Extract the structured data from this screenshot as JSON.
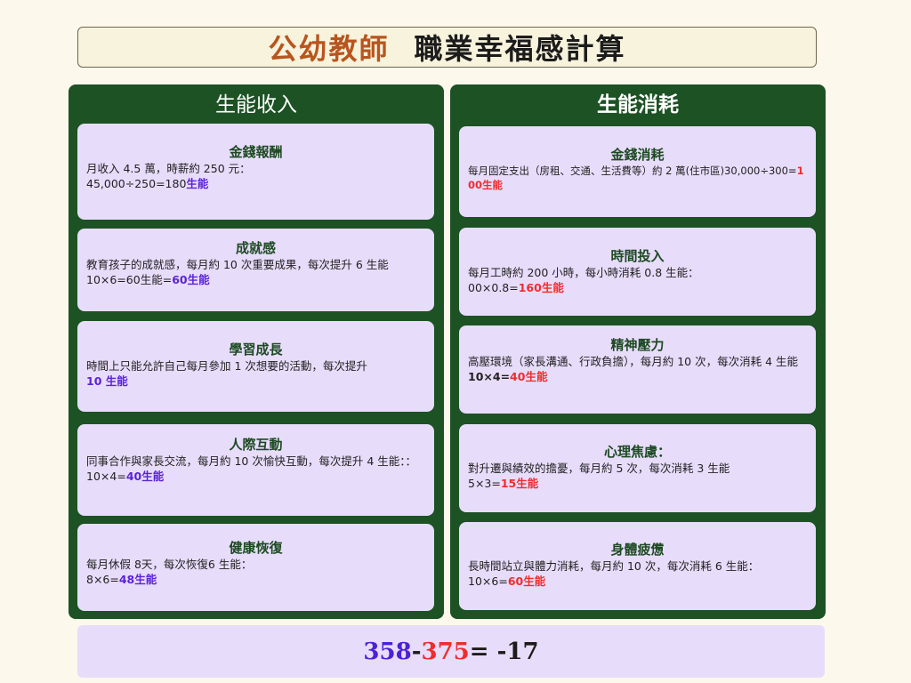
{
  "title": {
    "part1": "公幼教師",
    "part2": "職業幸福感計算"
  },
  "income": {
    "heading": "生能收入",
    "cards": [
      {
        "title": "金錢報酬",
        "line1": "月收入 4.5 萬，時薪約 250 元：",
        "calc": "45,000÷250=180",
        "result": "生能"
      },
      {
        "title": "成就感",
        "line1": "教育孩子的成就感，每月約 10 次重要成果，每次提升 6 生能",
        "calc": "10×6=60生能=",
        "result": "60生能"
      },
      {
        "title": "學習成長",
        "line1": "時間上只能允許自己每月參加 1 次想要的活動，每次提升",
        "result": "10 生能"
      },
      {
        "title": "人際互動",
        "line1": "同事合作與家長交流，每月約 10 次愉快互動，每次提升 4 生能：：",
        "calc": "10×4=",
        "result": "40生能"
      },
      {
        "title": "健康恢復",
        "line1": "每月休假 8天，每次恢復6 生能：",
        "calc": "8×6=",
        "result": "48生能"
      }
    ]
  },
  "expense": {
    "heading": "生能消耗",
    "cards": [
      {
        "title": "金錢消耗",
        "line1": "每月固定支出（房租、交通、生活費等）約 2 萬(住市區)30,000÷300=",
        "result": "100生能"
      },
      {
        "title": "時間投入",
        "line1": "每月工時約 200 小時，每小時消耗 0.8 生能：",
        "calc": "00×0.8=",
        "result": "160生能"
      },
      {
        "title": "精神壓力",
        "line1": "高壓環境（家長溝通、行政負擔），每月約 10 次，每次消耗 4 生能",
        "calc": "10×4=",
        "result": "40生能"
      },
      {
        "title": "心理焦慮：",
        "line1": "對升遷與績效的擔憂，每月約 5 次，每次消耗 3 生能",
        "calc": "5×3=",
        "result": "15生能"
      },
      {
        "title": "身體疲憊",
        "line1": "長時間站立與體力消耗，每月約 10 次，每次消耗 6 生能：",
        "calc": "10×6=",
        "result": "60生能"
      }
    ]
  },
  "formula": {
    "income_total": "358",
    "minus": "-",
    "expense_total": "375",
    "result": "= -17"
  },
  "colors": {
    "panel_bg": "#1d5224",
    "card_bg": "#e8dcfb",
    "income_accent": "#5a23d6",
    "expense_accent": "#ee2d2d",
    "title_accent": "#b8551f"
  }
}
